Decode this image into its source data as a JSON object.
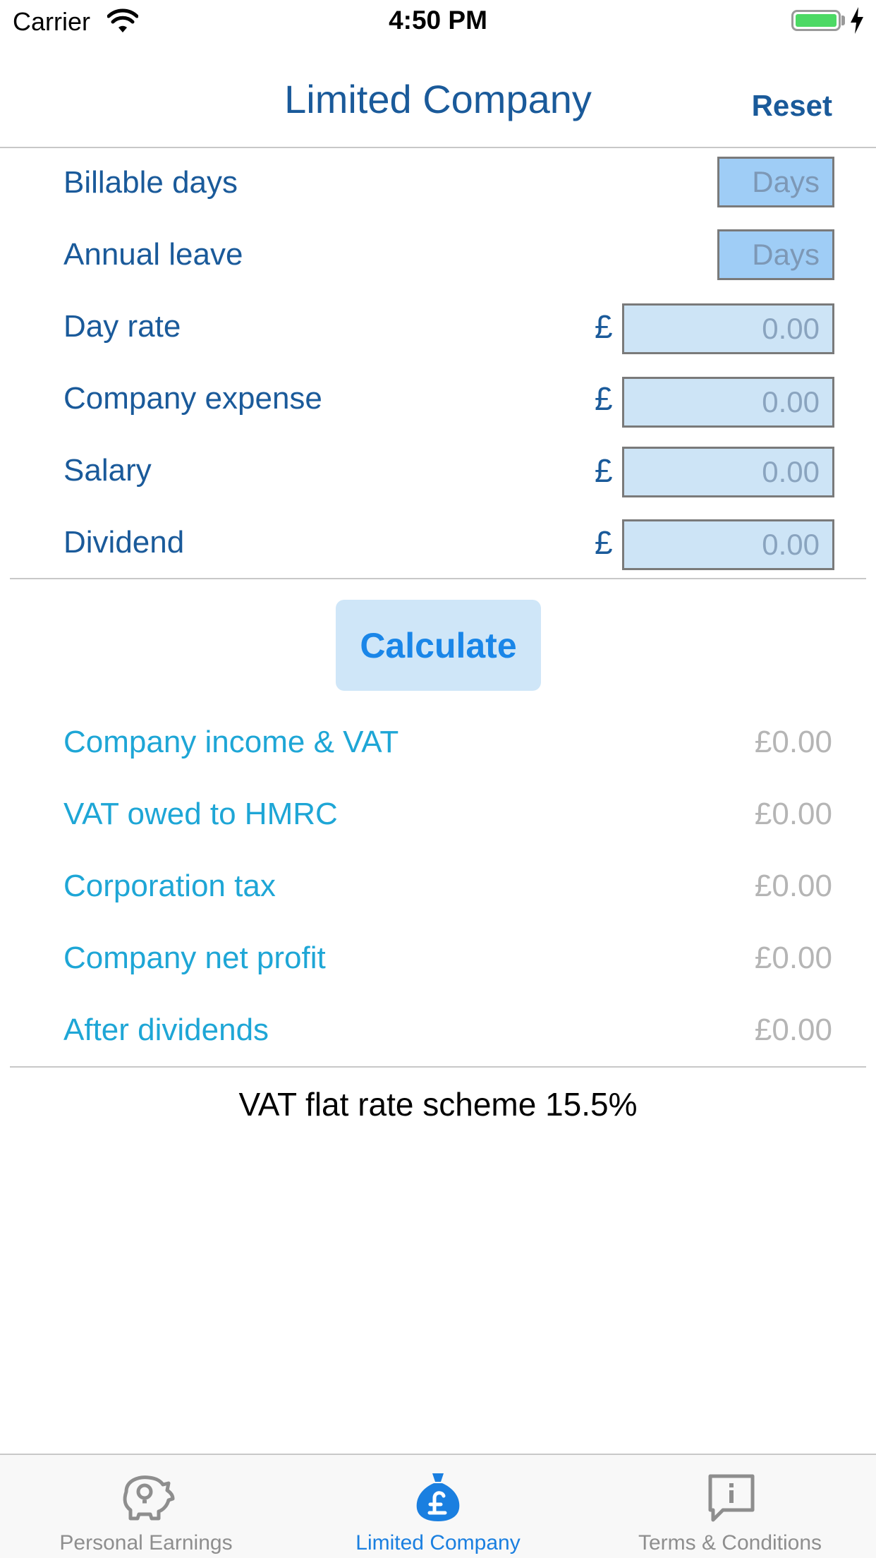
{
  "status_bar": {
    "carrier": "Carrier",
    "time": "4:50 PM"
  },
  "nav": {
    "title": "Limited Company",
    "reset_label": "Reset"
  },
  "inputs": [
    {
      "label": "Billable days",
      "placeholder": "Days",
      "currency": ""
    },
    {
      "label": "Annual leave",
      "placeholder": "Days",
      "currency": ""
    },
    {
      "label": "Day rate",
      "placeholder": "0.00",
      "currency": "£"
    },
    {
      "label": "Company expense",
      "placeholder": "0.00",
      "currency": "£"
    },
    {
      "label": "Salary",
      "placeholder": "0.00",
      "currency": "£"
    },
    {
      "label": "Dividend",
      "placeholder": "0.00",
      "currency": "£"
    }
  ],
  "calculate_label": "Calculate",
  "results": [
    {
      "label": "Company income & VAT",
      "value": "£0.00"
    },
    {
      "label": "VAT owed to HMRC",
      "value": "£0.00"
    },
    {
      "label": "Corporation tax",
      "value": "£0.00"
    },
    {
      "label": "Company net profit",
      "value": "£0.00"
    },
    {
      "label": "After dividends",
      "value": "£0.00"
    }
  ],
  "vat_note": "VAT flat rate scheme 15.5%",
  "tabs": [
    {
      "label": "Personal Earnings",
      "icon": "piggy-bank-icon",
      "active": false
    },
    {
      "label": "Limited Company",
      "icon": "money-bag-icon",
      "active": true
    },
    {
      "label": "Terms & Conditions",
      "icon": "info-speech-icon",
      "active": false
    }
  ],
  "colors": {
    "accent": "#1a5a9a",
    "result_label": "#1ea6d6",
    "tab_active": "#1a7fe0",
    "tab_inactive": "#8e8e8e"
  }
}
